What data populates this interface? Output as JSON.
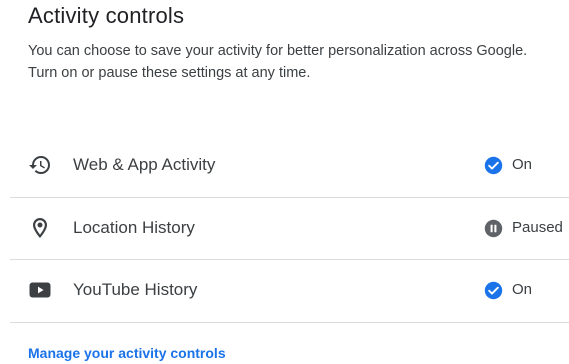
{
  "header": {
    "title": "Activity controls",
    "description": "You can choose to save your activity for better personalization across Google. Turn on or pause these settings at any time."
  },
  "controls": [
    {
      "label": "Web & App Activity",
      "status": "On",
      "icon": "history-icon",
      "status_icon": "check-circle-icon"
    },
    {
      "label": "Location History",
      "status": "Paused",
      "icon": "location-pin-icon",
      "status_icon": "pause-circle-icon"
    },
    {
      "label": "YouTube History",
      "status": "On",
      "icon": "youtube-icon",
      "status_icon": "check-circle-icon"
    }
  ],
  "footer": {
    "manage_link": "Manage your activity controls"
  },
  "colors": {
    "accent": "#1a73e8",
    "paused": "#5f6368",
    "text": "#3c4043",
    "divider": "#dadce0"
  }
}
